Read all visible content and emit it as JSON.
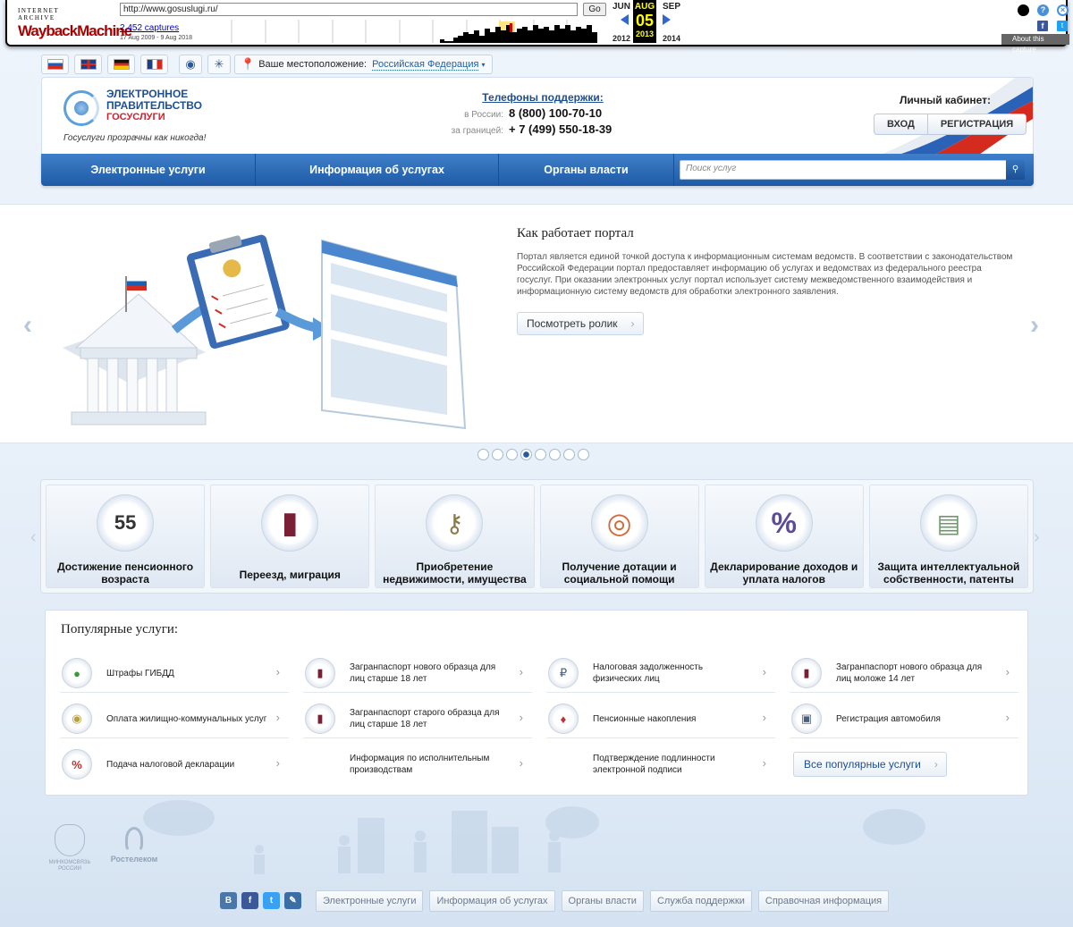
{
  "wayback": {
    "logo_top": "INTERNET ARCHIVE",
    "logo_main": "WaybackMachine",
    "url": "http://www.gosuslugi.ru/",
    "go_label": "Go",
    "captures": "2,452 captures",
    "range": "17 Aug 2009 - 9 Aug 2018",
    "prev_month": "JUN",
    "cur_month": "AUG",
    "next_month": "SEP",
    "cur_day": "05",
    "prev_year": "2012",
    "cur_year": "2013",
    "next_year": "2014",
    "about": "About this capture",
    "help_glyph": "?",
    "close_glyph": "×",
    "fb_glyph": "f",
    "tw_glyph": "t"
  },
  "topbar": {
    "languages": [
      "ru-flag",
      "gb-flag",
      "de-flag",
      "fr-flag"
    ],
    "tools": [
      "eye-icon",
      "compass-icon"
    ],
    "location_label": "Ваше местоположение:",
    "location_value": "Российская Федерация"
  },
  "header": {
    "logo_line1": "ЭЛЕКТРОННОЕ",
    "logo_line2": "ПРАВИТЕЛЬСТВО",
    "logo_sub": "ГОСУСЛУГИ",
    "slogan": "Госуслуги прозрачны как никогда!",
    "support_title": "Телефоны поддержки:",
    "phone_ru_label": "в России:",
    "phone_ru": "8 (800) 100-70-10",
    "phone_abroad_label": "за границей:",
    "phone_abroad": "+ 7 (499) 550-18-39",
    "cabinet_title": "Личный кабинет:",
    "login": "ВХОД",
    "register": "РЕГИСТРАЦИЯ"
  },
  "nav": {
    "items": [
      "Электронные услуги",
      "Информация об услугах",
      "Органы власти"
    ],
    "search_placeholder": "Поиск услуг",
    "search_icon": "search-icon"
  },
  "slider": {
    "title": "Как работает портал",
    "text": "Портал является единой точкой доступа к информационным системам ведомств. В соответствии с законодательством Российской Федерации портал предоставляет информацию об услугах и ведомствах из федерального реестра госуслуг. При оказании электронных услуг портал использует систему межведомственного взаимодействия и информационную систему ведомств для обработки электронного заявления.",
    "button": "Посмотреть ролик",
    "dots_total": 8,
    "active_dot": 4,
    "prev_icon": "chevron-left-icon",
    "next_icon": "chevron-right-icon"
  },
  "categories": [
    {
      "label": "Достижение пенсионного возраста",
      "icon": "calendar-icon",
      "glyph": "55"
    },
    {
      "label": "Переезд, миграция",
      "icon": "passport-icon",
      "glyph": "▮"
    },
    {
      "label": "Приобретение недвижимости, имущества",
      "icon": "keys-icon",
      "glyph": "⚷"
    },
    {
      "label": "Получение дотации и социальной помощи",
      "icon": "lifebuoy-icon",
      "glyph": "◎"
    },
    {
      "label": "Декларирование доходов и уплата налогов",
      "icon": "percent-icon",
      "glyph": "%"
    },
    {
      "label": "Защита интеллектуальной собственности, патенты",
      "icon": "certificate-icon",
      "glyph": "▤"
    }
  ],
  "popular": {
    "title": "Популярные услуги:",
    "items": [
      {
        "label": "Штрафы ГИБДД",
        "icon": "traffic-light-icon",
        "glyph": "●"
      },
      {
        "label": "Загранпаспорт нового образца для лиц старше 18 лет",
        "icon": "passport-icon",
        "glyph": "▮"
      },
      {
        "label": "Налоговая задолженность физических лиц",
        "icon": "tax-icon",
        "glyph": "₽"
      },
      {
        "label": "Загранпаспорт нового образца для лиц моложе 14 лет",
        "icon": "passport-icon",
        "glyph": "▮"
      },
      {
        "label": "Оплата жилищно-коммунальных услуг",
        "icon": "coins-icon",
        "glyph": "◉"
      },
      {
        "label": "Загранпаспорт старого образца для лиц старше 18 лет",
        "icon": "passport-icon",
        "glyph": "▮"
      },
      {
        "label": "Пенсионные накопления",
        "icon": "pension-icon",
        "glyph": "♦"
      },
      {
        "label": "Регистрация автомобиля",
        "icon": "car-document-icon",
        "glyph": "▣"
      },
      {
        "label": "Подача налоговой декларации",
        "icon": "declaration-icon",
        "glyph": "%"
      },
      {
        "label": "Информация по исполнительным производствам",
        "icon": "",
        "glyph": ""
      },
      {
        "label": "Подтверждение подлинности электронной подписи",
        "icon": "",
        "glyph": ""
      }
    ],
    "all_button": "Все популярные услуги"
  },
  "footer": {
    "ministry": "МИНКОМСВЯЗЬ РОССИИ",
    "rostelecom": "Ростелеком",
    "social": [
      {
        "icon": "vk-icon",
        "glyph": "B",
        "color": "#4a76a8"
      },
      {
        "icon": "facebook-icon",
        "glyph": "f",
        "color": "#3b5998"
      },
      {
        "icon": "twitter-icon",
        "glyph": "t",
        "color": "#38a1f3"
      },
      {
        "icon": "livejournal-icon",
        "glyph": "✎",
        "color": "#3b6ea5"
      }
    ],
    "links": [
      "Электронные услуги",
      "Информация об услугах",
      "Органы власти",
      "Служба поддержки",
      "Справочная информация"
    ]
  }
}
